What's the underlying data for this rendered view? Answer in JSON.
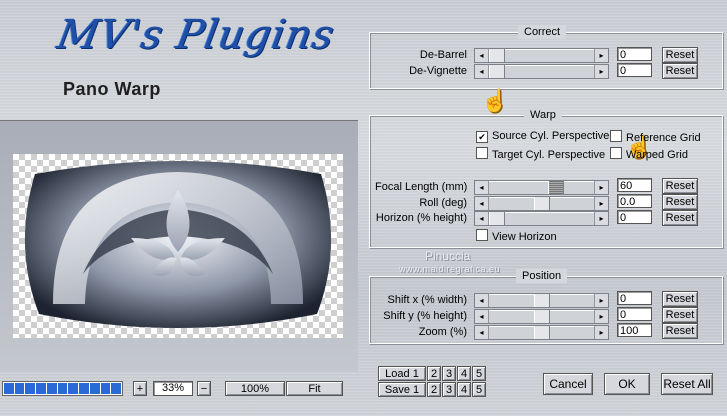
{
  "app": {
    "logo_text": "MV's Plugins",
    "subtitle": "Pano Warp"
  },
  "correct": {
    "title": "Correct",
    "rows": [
      {
        "label": "De-Barrel",
        "value": "0",
        "reset": "Reset",
        "position": 0.0
      },
      {
        "label": "De-Vignette",
        "value": "0",
        "reset": "Reset",
        "position": 0.0
      }
    ]
  },
  "warp": {
    "title": "Warp",
    "checks": {
      "source_cyl": {
        "label": "Source Cyl. Perspective",
        "checked": true,
        "mark": "✔"
      },
      "reference_grid": {
        "label": "Reference Grid",
        "checked": false
      },
      "target_cyl": {
        "label": "Target Cyl. Perspective",
        "checked": false
      },
      "warped_grid": {
        "label": "Warped Grid",
        "checked": false
      },
      "view_horizon": {
        "label": "View Horizon",
        "checked": false
      }
    },
    "rows": [
      {
        "label": "Focal Length (mm)",
        "value": "60",
        "reset": "Reset",
        "position": 0.58
      },
      {
        "label": "Roll (deg)",
        "value": "0.0",
        "reset": "Reset",
        "position": 0.5
      },
      {
        "label": "Horizon (% height)",
        "value": "0",
        "reset": "Reset",
        "position": 0.0
      }
    ]
  },
  "position": {
    "title": "Position",
    "rows": [
      {
        "label": "Shift x (% width)",
        "value": "0",
        "reset": "Reset",
        "position": 0.5
      },
      {
        "label": "Shift y (% height)",
        "value": "0",
        "reset": "Reset",
        "position": 0.5
      },
      {
        "label": "Zoom (%)",
        "value": "100",
        "reset": "Reset",
        "position": 0.5
      }
    ]
  },
  "watermark": {
    "name": "Pinuccia",
    "site": "www.maidiregrafica.eu"
  },
  "zoom": {
    "plus": "+",
    "value": "33%",
    "minus": "−",
    "hundred": "100%",
    "fit": "Fit"
  },
  "progress": {
    "fraction": 1.0,
    "segments": 11
  },
  "presets": {
    "load_label": "Load 1",
    "save_label": "Save 1",
    "slots": [
      "2",
      "3",
      "4",
      "5"
    ]
  },
  "actions": {
    "cancel": "Cancel",
    "ok": "OK",
    "reset_all": "Reset All"
  },
  "icons": {
    "pointer": "pointing-hand-icon",
    "arrow_left": "◂",
    "arrow_right": "▸"
  },
  "colors": {
    "logo": "#1f4fa6",
    "progress": "#2a6ad6",
    "pointer": "#f2c200"
  }
}
